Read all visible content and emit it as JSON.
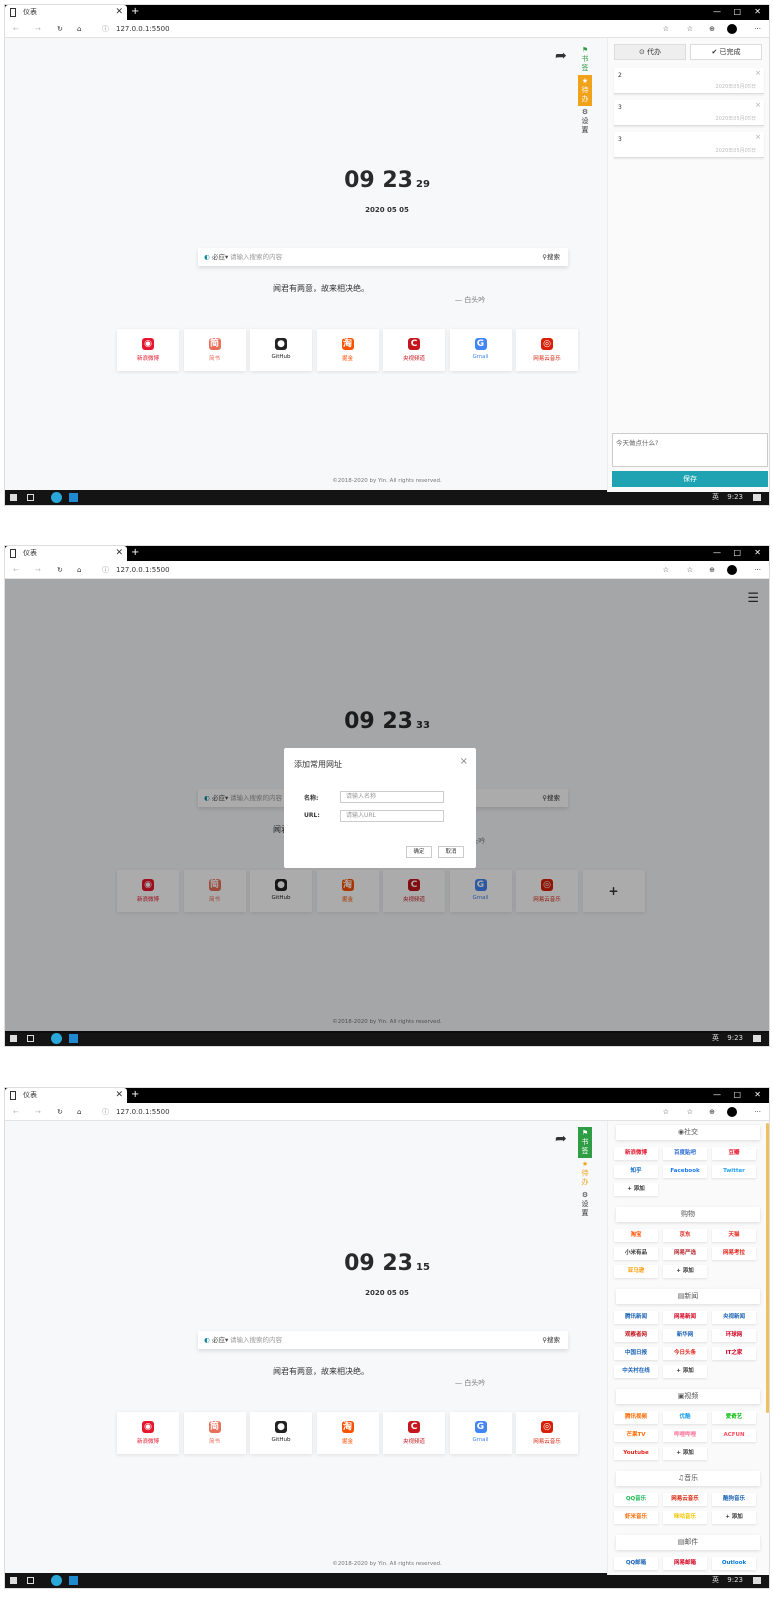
{
  "browser": {
    "tab_title": "仪表",
    "address": "127.0.0.1:5500",
    "new_tab": "+",
    "window_controls": {
      "min": "—",
      "max": "□",
      "close": "✕"
    },
    "nav": {
      "back": "←",
      "forward": "→",
      "reload": "↻",
      "home": "⌂",
      "info": "ⓘ"
    },
    "toolbar_icons": {
      "fav": "☆",
      "collections": "☆",
      "extensions": "⊕",
      "more": "···"
    }
  },
  "taskbar": {
    "time": "9:23",
    "ime": "英"
  },
  "page": {
    "date": "2020 05 05",
    "search_engine": "必应",
    "search_engine_arrow": "▾",
    "search_placeholder": "请输入搜索的内容",
    "search_button": "搜索",
    "quote": "闻君有两意，故来相决绝。",
    "quote_author": "— 白头吟",
    "footer": "©2018-2020 by Yin. All rights reserved.",
    "bookmarks": [
      {
        "label": "新浪微博",
        "glyph": "◉",
        "color": "#e6162d"
      },
      {
        "label": "简书",
        "glyph": "简",
        "color": "#ea6f5a"
      },
      {
        "label": "GitHub",
        "glyph": "●",
        "color": "#222222"
      },
      {
        "label": "掘金",
        "glyph": "淘",
        "color": "#ff5000"
      },
      {
        "label": "央视频道",
        "glyph": "C",
        "color": "#c4161c"
      },
      {
        "label": "Gmail",
        "glyph": "G",
        "color": "#4285f4"
      },
      {
        "label": "网易云音乐",
        "glyph": "◎",
        "color": "#d81e06"
      }
    ],
    "add_card": "+"
  },
  "side_nav": {
    "bookmarks": "书签",
    "todo": "待办",
    "settings": "设置"
  },
  "screen1": {
    "clock": {
      "hm": "09 23",
      "sec": "29"
    },
    "todo_tab": "⊙ 代办",
    "done_tab": "✔ 已完成",
    "notes": [
      {
        "num": "2",
        "time": "2020年05月05日"
      },
      {
        "num": "3",
        "time": "2020年05月05日"
      },
      {
        "num": "3",
        "time": "2020年05月05日"
      }
    ],
    "note_close": "×",
    "textarea_placeholder": "今天做点什么?",
    "save_button": "保存"
  },
  "screen2": {
    "clock": {
      "hm": "09 23",
      "sec": "33"
    },
    "modal": {
      "title": "添加常用网址",
      "close": "×",
      "name_label": "名称:",
      "name_placeholder": "请输入名称",
      "url_label": "URL:",
      "url_placeholder": "请输入URL",
      "confirm": "确定",
      "cancel": "取消"
    }
  },
  "screen3": {
    "clock": {
      "hm": "09 23",
      "sec": "15"
    },
    "categories": [
      {
        "name": "◉社交",
        "chips": [
          {
            "label": "新浪微博",
            "color": "#e6162d"
          },
          {
            "label": "百度贴吧",
            "color": "#2b6bd6"
          },
          {
            "label": "豆瓣",
            "color": "#e6162d"
          },
          {
            "label": "知乎",
            "color": "#0a66c2"
          },
          {
            "label": "Facebook",
            "color": "#1877f2"
          },
          {
            "label": "Twitter",
            "color": "#1da1f2"
          },
          {
            "label": "+ 添加",
            "color": "#333333"
          }
        ]
      },
      {
        "name": "购物",
        "chips": [
          {
            "label": "淘宝",
            "color": "#ff5000"
          },
          {
            "label": "京东",
            "color": "#e1251b"
          },
          {
            "label": "天猫",
            "color": "#e1251b"
          },
          {
            "label": "小米有品",
            "color": "#333333"
          },
          {
            "label": "网易严选",
            "color": "#b4282d"
          },
          {
            "label": "网易考拉",
            "color": "#e1251b"
          },
          {
            "label": "亚马逊",
            "color": "#ff9900"
          },
          {
            "label": "+ 添加",
            "color": "#333333"
          }
        ]
      },
      {
        "name": "▤新闻",
        "chips": [
          {
            "label": "腾讯新闻",
            "color": "#1a62b4"
          },
          {
            "label": "网易新闻",
            "color": "#d4001e"
          },
          {
            "label": "央视新闻",
            "color": "#1a62b4"
          },
          {
            "label": "观察者网",
            "color": "#c4161c"
          },
          {
            "label": "新华网",
            "color": "#1a62b4"
          },
          {
            "label": "环球网",
            "color": "#d4001e"
          },
          {
            "label": "中国日报",
            "color": "#1a62b4"
          },
          {
            "label": "今日头条",
            "color": "#e1251b"
          },
          {
            "label": "IT之家",
            "color": "#d4001e"
          },
          {
            "label": "中关村在线",
            "color": "#1a62b4"
          },
          {
            "label": "+ 添加",
            "color": "#333333"
          }
        ]
      },
      {
        "name": "▣视频",
        "chips": [
          {
            "label": "腾讯视频",
            "color": "#ff6a00"
          },
          {
            "label": "优酷",
            "color": "#1ea1f2"
          },
          {
            "label": "爱奇艺",
            "color": "#00be06"
          },
          {
            "label": "芒果TV",
            "color": "#ff6a00"
          },
          {
            "label": "哔哩哔哩",
            "color": "#fb7299"
          },
          {
            "label": "ACFUN",
            "color": "#fd4c5d"
          },
          {
            "label": "Youtube",
            "color": "#e1251b"
          },
          {
            "label": "+ 添加",
            "color": "#333333"
          }
        ]
      },
      {
        "name": "♫音乐",
        "chips": [
          {
            "label": "QQ音乐",
            "color": "#1db954"
          },
          {
            "label": "网易云音乐",
            "color": "#d81e06"
          },
          {
            "label": "酷狗音乐",
            "color": "#1a62b4"
          },
          {
            "label": "虾米音乐",
            "color": "#ff6a00"
          },
          {
            "label": "咪咕音乐",
            "color": "#f3c500"
          },
          {
            "label": "+ 添加",
            "color": "#333333"
          }
        ]
      },
      {
        "name": "▤邮件",
        "chips": [
          {
            "label": "QQ邮箱",
            "color": "#1a62b4"
          },
          {
            "label": "网易邮箱",
            "color": "#d4001e"
          },
          {
            "label": "Outlook",
            "color": "#0078d4"
          }
        ]
      }
    ]
  },
  "colors": {
    "accent": "#1fa3b3",
    "tag_green": "#2e9d44",
    "tag_orange": "#f0a21a"
  }
}
